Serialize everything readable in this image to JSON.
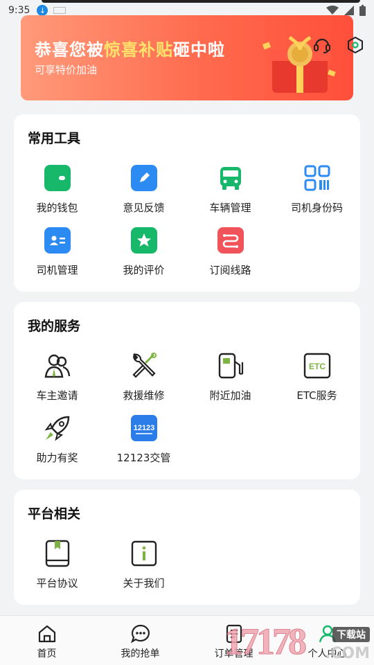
{
  "status_bar": {
    "time": "9:35"
  },
  "banner": {
    "title_before": "恭喜您被",
    "title_highlight": "惊喜补贴",
    "title_after": "砸中啦",
    "subtitle": "可享特价加油"
  },
  "common_tools": {
    "heading": "常用工具",
    "items": [
      {
        "label": "我的钱包",
        "icon": "wallet-icon",
        "color": "#17b86a"
      },
      {
        "label": "意见反馈",
        "icon": "pencil-icon",
        "color": "#2b8bf2"
      },
      {
        "label": "车辆管理",
        "icon": "bus-icon",
        "color": "#17b86a"
      },
      {
        "label": "司机身份码",
        "icon": "qr-code-icon",
        "color": "#2b8bf2"
      },
      {
        "label": "司机管理",
        "icon": "id-card-icon",
        "color": "#2b8bf2"
      },
      {
        "label": "我的评价",
        "icon": "star-icon",
        "color": "#17b86a"
      },
      {
        "label": "订阅线路",
        "icon": "route-icon",
        "color": "#f0545a"
      }
    ]
  },
  "my_services": {
    "heading": "我的服务",
    "items": [
      {
        "label": "车主邀请",
        "icon": "users-icon"
      },
      {
        "label": "救援维修",
        "icon": "tools-icon"
      },
      {
        "label": "附近加油",
        "icon": "fuel-pump-icon"
      },
      {
        "label": "ETC服务",
        "icon": "etc-icon"
      },
      {
        "label": "助力有奖",
        "icon": "rocket-icon"
      },
      {
        "label": "12123交管",
        "icon": "12123-app-icon"
      }
    ],
    "etc_badge": "ETC",
    "app_badge": "12123"
  },
  "platform": {
    "heading": "平台相关",
    "items": [
      {
        "label": "平台协议",
        "icon": "book-icon"
      },
      {
        "label": "关于我们",
        "icon": "info-icon"
      }
    ]
  },
  "tab_bar": {
    "tabs": [
      {
        "label": "首页",
        "icon": "home-icon"
      },
      {
        "label": "我的抢单",
        "icon": "chat-icon"
      },
      {
        "label": "订单管理",
        "icon": "order-list-icon"
      },
      {
        "label": "个人中心",
        "icon": "user-icon"
      }
    ]
  },
  "watermark": {
    "number": "17178",
    "badge": "下载站",
    "suffix": ".COM"
  },
  "colors": {
    "accent_green": "#17b86a",
    "accent_blue": "#2b8bf2",
    "accent_red": "#f0545a",
    "service_green": "#7cb342"
  }
}
